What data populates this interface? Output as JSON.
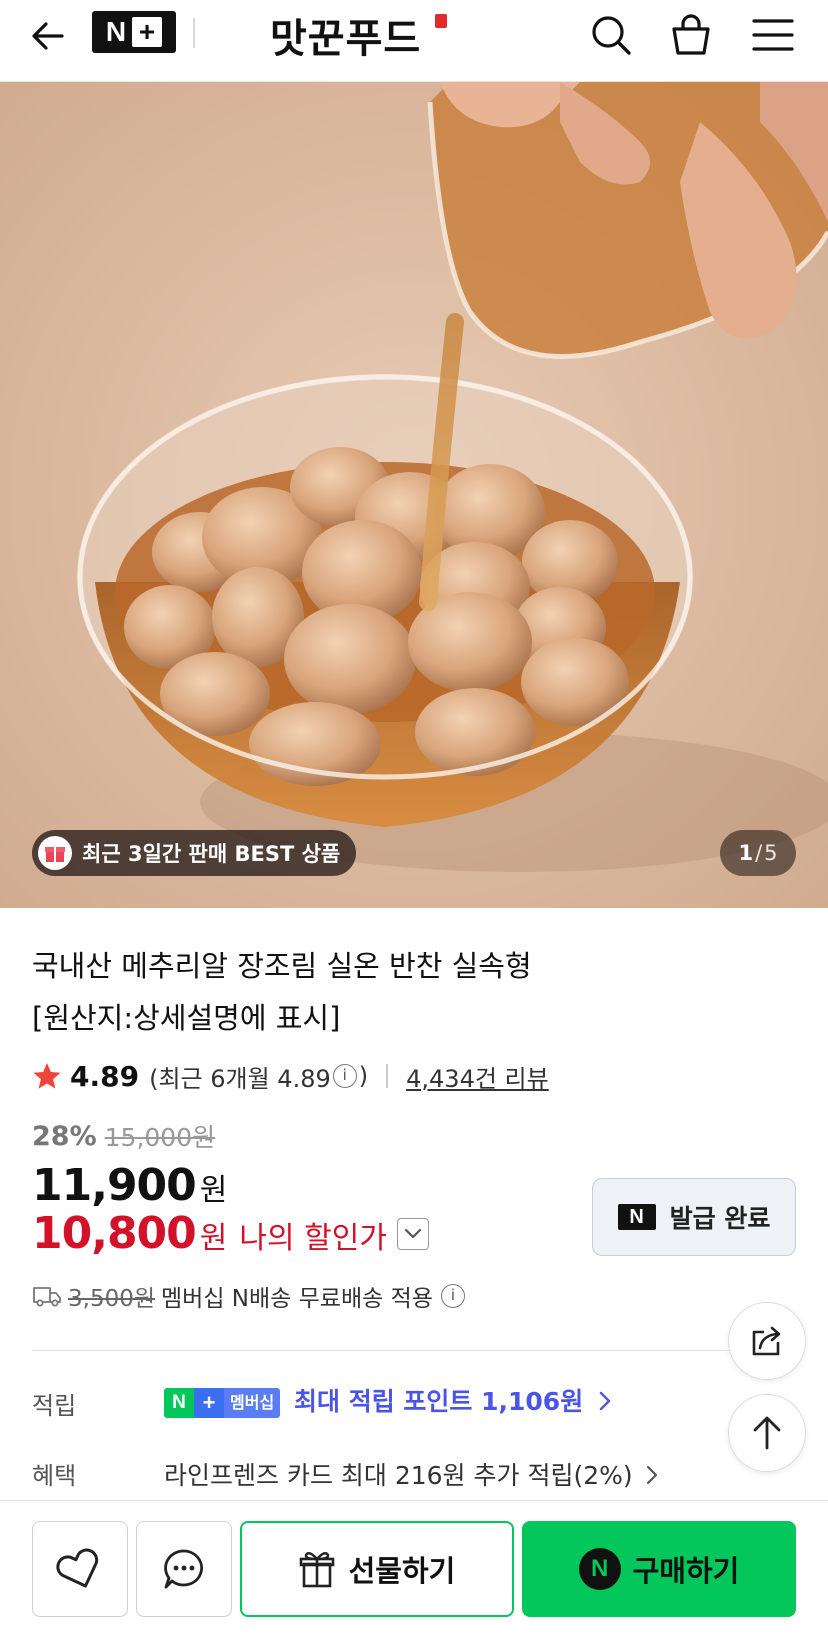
{
  "header": {
    "back_icon": "arrow-left-icon",
    "logo_n": "N",
    "logo_plus": "+",
    "store_name": "맛꾼푸드",
    "icons": [
      "search-icon",
      "shopping-bag-icon",
      "menu-icon"
    ]
  },
  "hero": {
    "badge_text": "최근 3일간 판매 BEST 상품",
    "counter_current": "1",
    "counter_sep": "/",
    "counter_total": "5"
  },
  "product": {
    "title_line1": "국내산 메추리알 장조림 실온 반찬 실속형",
    "title_line2": "[원산지:상세설명에 표시]",
    "rating": "4.89",
    "recent_rating_open": "(최근 6개월 4.89",
    "info_glyph": "i",
    "recent_rating_close": ")",
    "review_count": "4,434건 리뷰",
    "discount_rate": "28%",
    "original_price": "15,000원",
    "price": "11,900",
    "price_unit": "원",
    "my_price": "10,800",
    "my_price_unit": "원",
    "my_price_label": "나의 할인가",
    "coupon_mark": "N",
    "coupon_label": "발급 완료",
    "shipping_original": "3,500원",
    "shipping_text": "멤버십 N배송 무료배송 적용"
  },
  "benefits": {
    "points_label": "적립",
    "badge_n": "N",
    "badge_plus": "+",
    "badge_membership": "멤버십",
    "points_text": "최대 적립 포인트 1,106원",
    "benefit_label": "혜택",
    "benefit_text": "라인프렌즈 카드 최대 216원 추가 적립(2%)"
  },
  "bottom_bar": {
    "gift_label": "선물하기",
    "buy_mark": "N",
    "buy_label": "구매하기"
  },
  "colors": {
    "naver_green": "#03c75a",
    "price_red": "#d3122a",
    "points_blue": "#4a55e8"
  }
}
